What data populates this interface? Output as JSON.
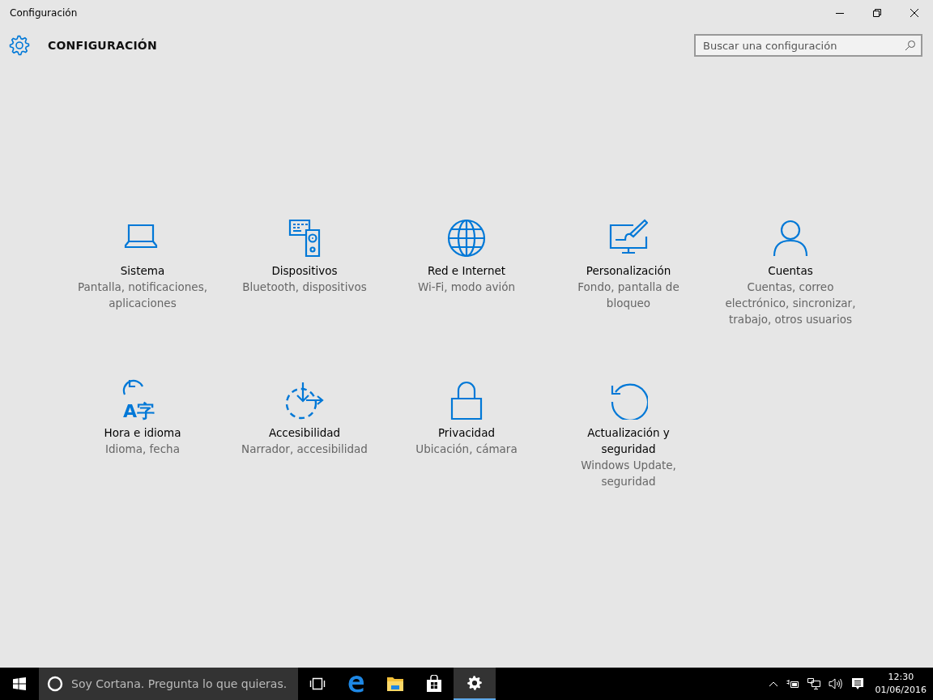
{
  "window": {
    "title": "Configuración"
  },
  "header": {
    "title": "CONFIGURACIÓN",
    "search": {
      "placeholder": "Buscar una configuración"
    }
  },
  "categories": [
    {
      "kind": "laptop",
      "title": "Sistema",
      "subtitle": "Pantalla, notificaciones, aplicaciones"
    },
    {
      "kind": "devices",
      "title": "Dispositivos",
      "subtitle": "Bluetooth, dispositivos"
    },
    {
      "kind": "globe",
      "title": "Red e Internet",
      "subtitle": "Wi-Fi, modo avión"
    },
    {
      "kind": "paint",
      "title": "Personalización",
      "subtitle": "Fondo, pantalla de bloqueo"
    },
    {
      "kind": "person",
      "title": "Cuentas",
      "subtitle": "Cuentas, correo electrónico, sincronizar, trabajo, otros usuarios"
    },
    {
      "kind": "time",
      "title": "Hora e idioma",
      "subtitle": "Idioma, fecha",
      "glyph": "A字"
    },
    {
      "kind": "access",
      "title": "Accesibilidad",
      "subtitle": "Narrador, accesibilidad"
    },
    {
      "kind": "lock",
      "title": "Privacidad",
      "subtitle": "Ubicación, cámara"
    },
    {
      "kind": "update",
      "title": "Actualización y seguridad",
      "subtitle": "Windows Update, seguridad"
    }
  ],
  "taskbar": {
    "search_placeholder": "Soy Cortana. Pregunta lo que quieras.",
    "apps": [
      {
        "kind": "taskview",
        "selected": false
      },
      {
        "kind": "edge",
        "selected": false
      },
      {
        "kind": "folder",
        "selected": false
      },
      {
        "kind": "store",
        "selected": false
      },
      {
        "kind": "gear",
        "selected": true
      }
    ],
    "time": "12:30",
    "date": "01/06/2016"
  }
}
